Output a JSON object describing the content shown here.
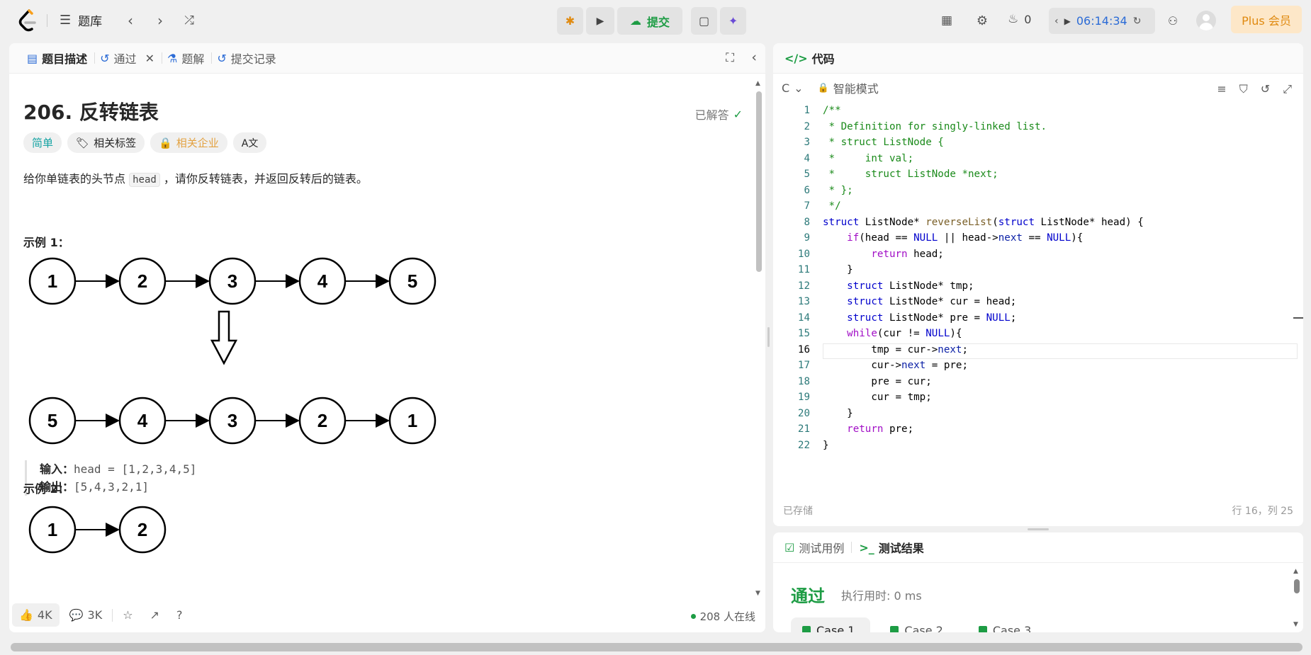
{
  "topbar": {
    "problem_list_label": "题库",
    "submit_label": "提交",
    "streak_count": "0",
    "timer": "06:14:34",
    "plus_label": "Plus 会员"
  },
  "left_panel": {
    "tabs": [
      {
        "label": "题目描述",
        "icon": "description-icon"
      },
      {
        "label": "通过",
        "icon": "history-icon"
      },
      {
        "label": "题解",
        "icon": "flask-icon"
      },
      {
        "label": "提交记录",
        "icon": "history-icon"
      }
    ],
    "problem_title": "206. 反转链表",
    "solved_label": "已解答",
    "badges": {
      "difficulty": "简单",
      "tags": "相关标签",
      "company": "相关企业"
    },
    "description_prefix": "给你单链表的头节点",
    "description_code": "head",
    "description_suffix": "，请你反转链表，并返回反转后的链表。",
    "example1_heading": "示例 1：",
    "example1_input_label": "输入：",
    "example1_input_value": "head = [1,2,3,4,5]",
    "example1_output_label": "输出：",
    "example1_output_value": "[5,4,3,2,1]",
    "example2_heading": "示例 2：",
    "diagram": {
      "row1": [
        "1",
        "2",
        "3",
        "4",
        "5"
      ],
      "row2": [
        "5",
        "4",
        "3",
        "2",
        "1"
      ],
      "row3": [
        "1",
        "2"
      ]
    },
    "footer": {
      "likes": "4K",
      "comments": "3K",
      "online": "208 人在线"
    }
  },
  "code_panel": {
    "title": "代码",
    "language": "C",
    "mode": "智能模式",
    "saved": "已存储",
    "cursor_position": "行 16，列 25",
    "current_line": 16,
    "lines": [
      "/**",
      " * Definition for singly-linked list.",
      " * struct ListNode {",
      " *     int val;",
      " *     struct ListNode *next;",
      " * };",
      " */",
      "struct ListNode* reverseList(struct ListNode* head) {",
      "    if(head == NULL || head->next == NULL){",
      "        return head;",
      "    }",
      "    struct ListNode* tmp;",
      "    struct ListNode* cur = head;",
      "    struct ListNode* pre = NULL;",
      "    while(cur != NULL){",
      "        tmp = cur->next;",
      "        cur->next = pre;",
      "        pre = cur;",
      "        cur = tmp;",
      "    }",
      "    return pre;",
      "}"
    ]
  },
  "result_panel": {
    "tab_testcase": "测试用例",
    "tab_result": "测试结果",
    "status": "通过",
    "runtime": "执行用时: 0 ms",
    "cases": [
      "Case 1",
      "Case 2",
      "Case 3"
    ]
  },
  "colors": {
    "accent_green": "#1d9c44",
    "easy_teal": "#15a3a3",
    "company_orange": "#e3a241",
    "plus_orange": "#e08a10"
  }
}
